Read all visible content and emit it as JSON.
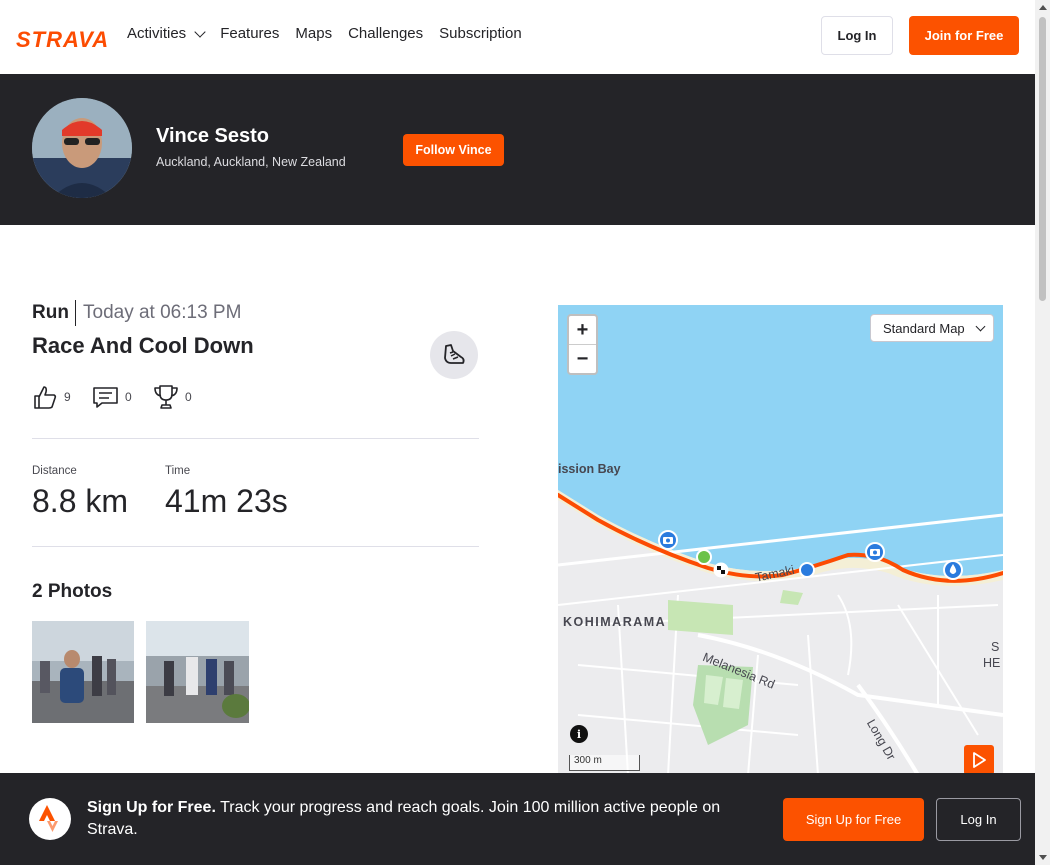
{
  "nav": {
    "logo": "STRAVA",
    "links": [
      "Activities",
      "Features",
      "Maps",
      "Challenges",
      "Subscription"
    ],
    "login_label": "Log In",
    "join_label": "Join for Free"
  },
  "athlete": {
    "name": "Vince Sesto",
    "location": "Auckland, Auckland, New Zealand",
    "follow_label": "Follow Vince"
  },
  "activity": {
    "type": "Run",
    "date": "Today at 06:13 PM",
    "title": "Race And Cool Down",
    "kudos": "9",
    "comments": "0",
    "achievements": "0",
    "stats": [
      {
        "label": "Distance",
        "value": "8.8 km"
      },
      {
        "label": "Time",
        "value": "41m 23s"
      }
    ],
    "photos_heading": "2 Photos"
  },
  "map": {
    "zoom_in": "+",
    "zoom_out": "−",
    "style_select": "Standard Map",
    "labels": {
      "bay": "ission Bay",
      "suburb": "KOHIMARAMA",
      "road1": "Melanesia Rd",
      "road2": "Long Dr",
      "road3": "Tamaki",
      "edge1": "S",
      "edge2": "HE"
    },
    "info": "i",
    "scale": "300 m"
  },
  "banner": {
    "bold": "Sign Up for Free.",
    "text": " Track your progress and reach goals. Join 100 million active people on Strava.",
    "signup_label": "Sign Up for Free",
    "login_label": "Log In"
  },
  "colors": {
    "brand": "#fc5200",
    "dark": "#242428",
    "water": "#8fd3f4"
  }
}
